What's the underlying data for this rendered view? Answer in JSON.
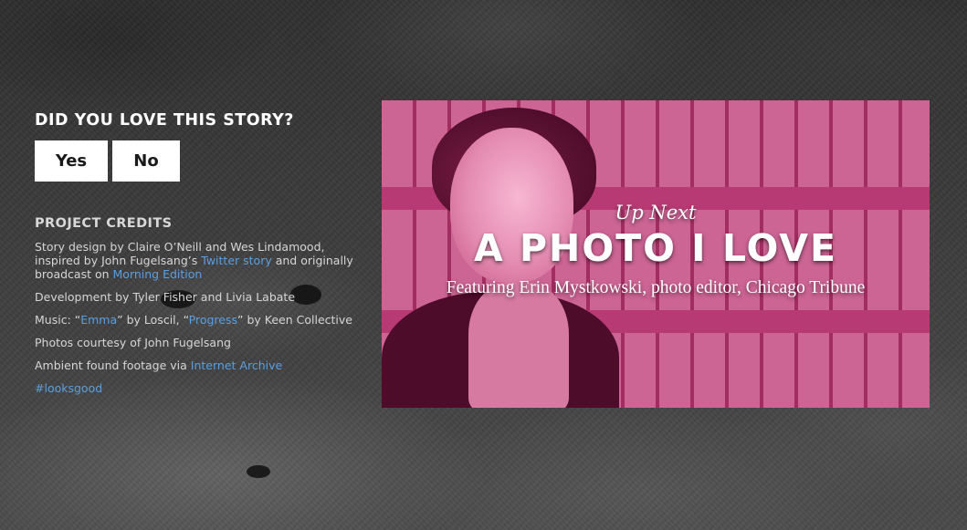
{
  "feedback": {
    "question": "DID YOU LOVE THIS STORY?",
    "yes_label": "Yes",
    "no_label": "No"
  },
  "credits": {
    "title": "PROJECT CREDITS",
    "story_design": {
      "part1": "Story design by Claire O’Neill and Wes Lindamood, inspired by John Fugelsang’s ",
      "link1": "Twitter story",
      "part2": " and originally broadcast on ",
      "link2": "Morning Edition"
    },
    "development": "Development by Tyler Fisher and Livia Labate",
    "music": {
      "part1": "Music: “",
      "link1": "Emma",
      "part2": "” by Loscil, “",
      "link2": "Progress",
      "part3": "” by Keen Collective"
    },
    "photos": "Photos courtesy of John Fugelsang",
    "ambient": {
      "part1": "Ambient found footage via ",
      "link1": "Internet Archive"
    },
    "hashtag": "#looksgood"
  },
  "up_next": {
    "kicker": "Up Next",
    "title": "A PHOTO I LOVE",
    "featuring": "Featuring Erin Mystkowski, photo editor, Chicago Tribune"
  },
  "colors": {
    "link": "#5b9fdf",
    "promo_tint": "#b83a74",
    "text": "#ffffff"
  }
}
